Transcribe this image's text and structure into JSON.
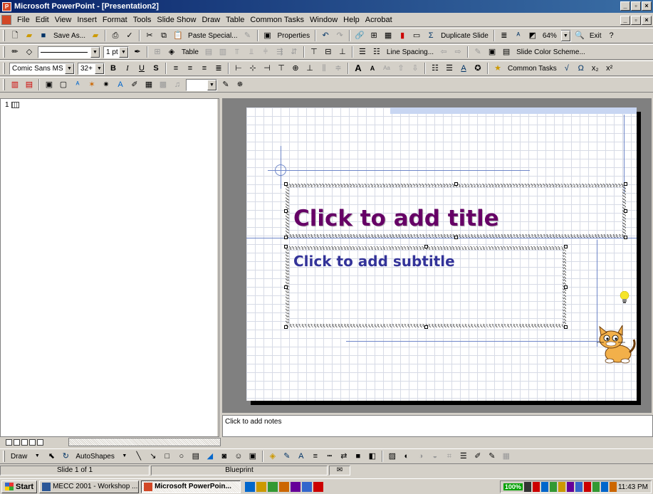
{
  "window": {
    "title": "Microsoft PowerPoint - [Presentation2]"
  },
  "menubar": {
    "items": [
      "File",
      "Edit",
      "View",
      "Insert",
      "Format",
      "Tools",
      "Slide Show",
      "Draw",
      "Table",
      "Common Tasks",
      "Window",
      "Help",
      "Acrobat"
    ]
  },
  "standard_toolbar": {
    "save_as": "Save As...",
    "paste_special": "Paste Special...",
    "properties": "Properties",
    "duplicate_slide": "Duplicate Slide",
    "zoom": "64%",
    "exit": "Exit"
  },
  "drawing_toolbar1": {
    "line_weight": "1 pt",
    "table": "Table",
    "line_spacing": "Line Spacing...",
    "slide_color_scheme": "Slide Color Scheme..."
  },
  "formatting_toolbar": {
    "font": "Comic Sans MS",
    "font_size": "32+",
    "common_tasks": "Common Tasks"
  },
  "outline": {
    "slide_number": "1"
  },
  "slide": {
    "title_placeholder": "Click to add title",
    "subtitle_placeholder": "Click to add subtitle",
    "title_color": "#660066",
    "subtitle_color": "#333399"
  },
  "notes": {
    "placeholder": "Click to add notes"
  },
  "draw_toolbar": {
    "draw": "Draw",
    "autoshapes": "AutoShapes"
  },
  "statusbar": {
    "slide_info": "Slide 1 of 1",
    "design": "Blueprint"
  },
  "taskbar": {
    "start": "Start",
    "task1": "MECC 2001 - Workshop ...",
    "task2": "Microsoft PowerPoin...",
    "zoom_indicator": "100%",
    "clock": "11:43 PM"
  }
}
